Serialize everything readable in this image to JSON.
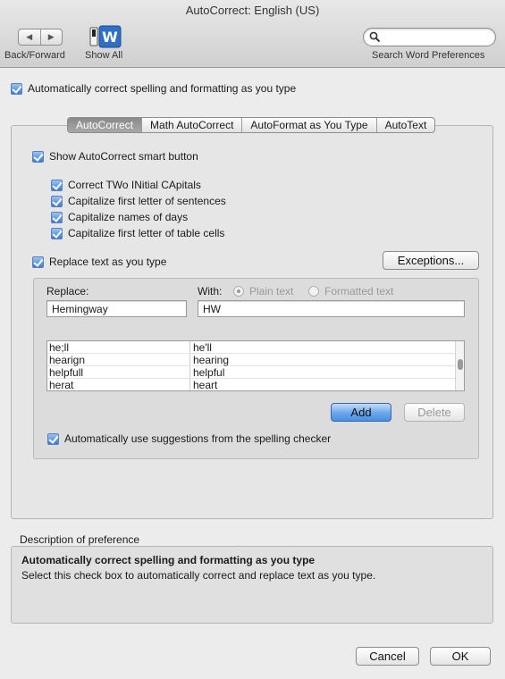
{
  "window": {
    "title": "AutoCorrect: English (US)"
  },
  "toolbar": {
    "back_forward_label": "Back/Forward",
    "show_all_label": "Show All",
    "search_placeholder": "",
    "search_caption": "Search Word Preferences"
  },
  "main": {
    "auto_correct_label": "Automatically correct spelling and formatting as you type"
  },
  "tabs": [
    {
      "label": "AutoCorrect",
      "active": true
    },
    {
      "label": "Math AutoCorrect",
      "active": false
    },
    {
      "label": "AutoFormat as You Type",
      "active": false
    },
    {
      "label": "AutoText",
      "active": false
    }
  ],
  "autocorrect": {
    "show_smart_button_label": "Show AutoCorrect smart button",
    "options": [
      "Correct TWo INitial CApitals",
      "Capitalize first letter of sentences",
      "Capitalize names of days",
      "Capitalize first letter of table cells"
    ],
    "replace_text_label": "Replace text as you type",
    "exceptions_button": "Exceptions...",
    "replace_label": "Replace:",
    "with_label": "With:",
    "plain_text_label": "Plain text",
    "formatted_text_label": "Formatted text",
    "replace_value": "Hemingway",
    "with_value": "HW",
    "entries": [
      {
        "replace": "he;ll",
        "with": "he'll"
      },
      {
        "replace": "hearign",
        "with": "hearing"
      },
      {
        "replace": "helpfull",
        "with": "helpful"
      },
      {
        "replace": "herat",
        "with": "heart"
      }
    ],
    "add_button": "Add",
    "delete_button": "Delete",
    "suggestions_label": "Automatically use suggestions from the spelling checker"
  },
  "description": {
    "section_label": "Description of preference",
    "heading": "Automatically correct spelling and formatting as you type",
    "body": "Select this check box to automatically correct and replace text as you type."
  },
  "footer": {
    "cancel_button": "Cancel",
    "ok_button": "OK"
  },
  "colors": {
    "accent_blue": "#4a8fe5",
    "window_bg": "#ececec"
  }
}
